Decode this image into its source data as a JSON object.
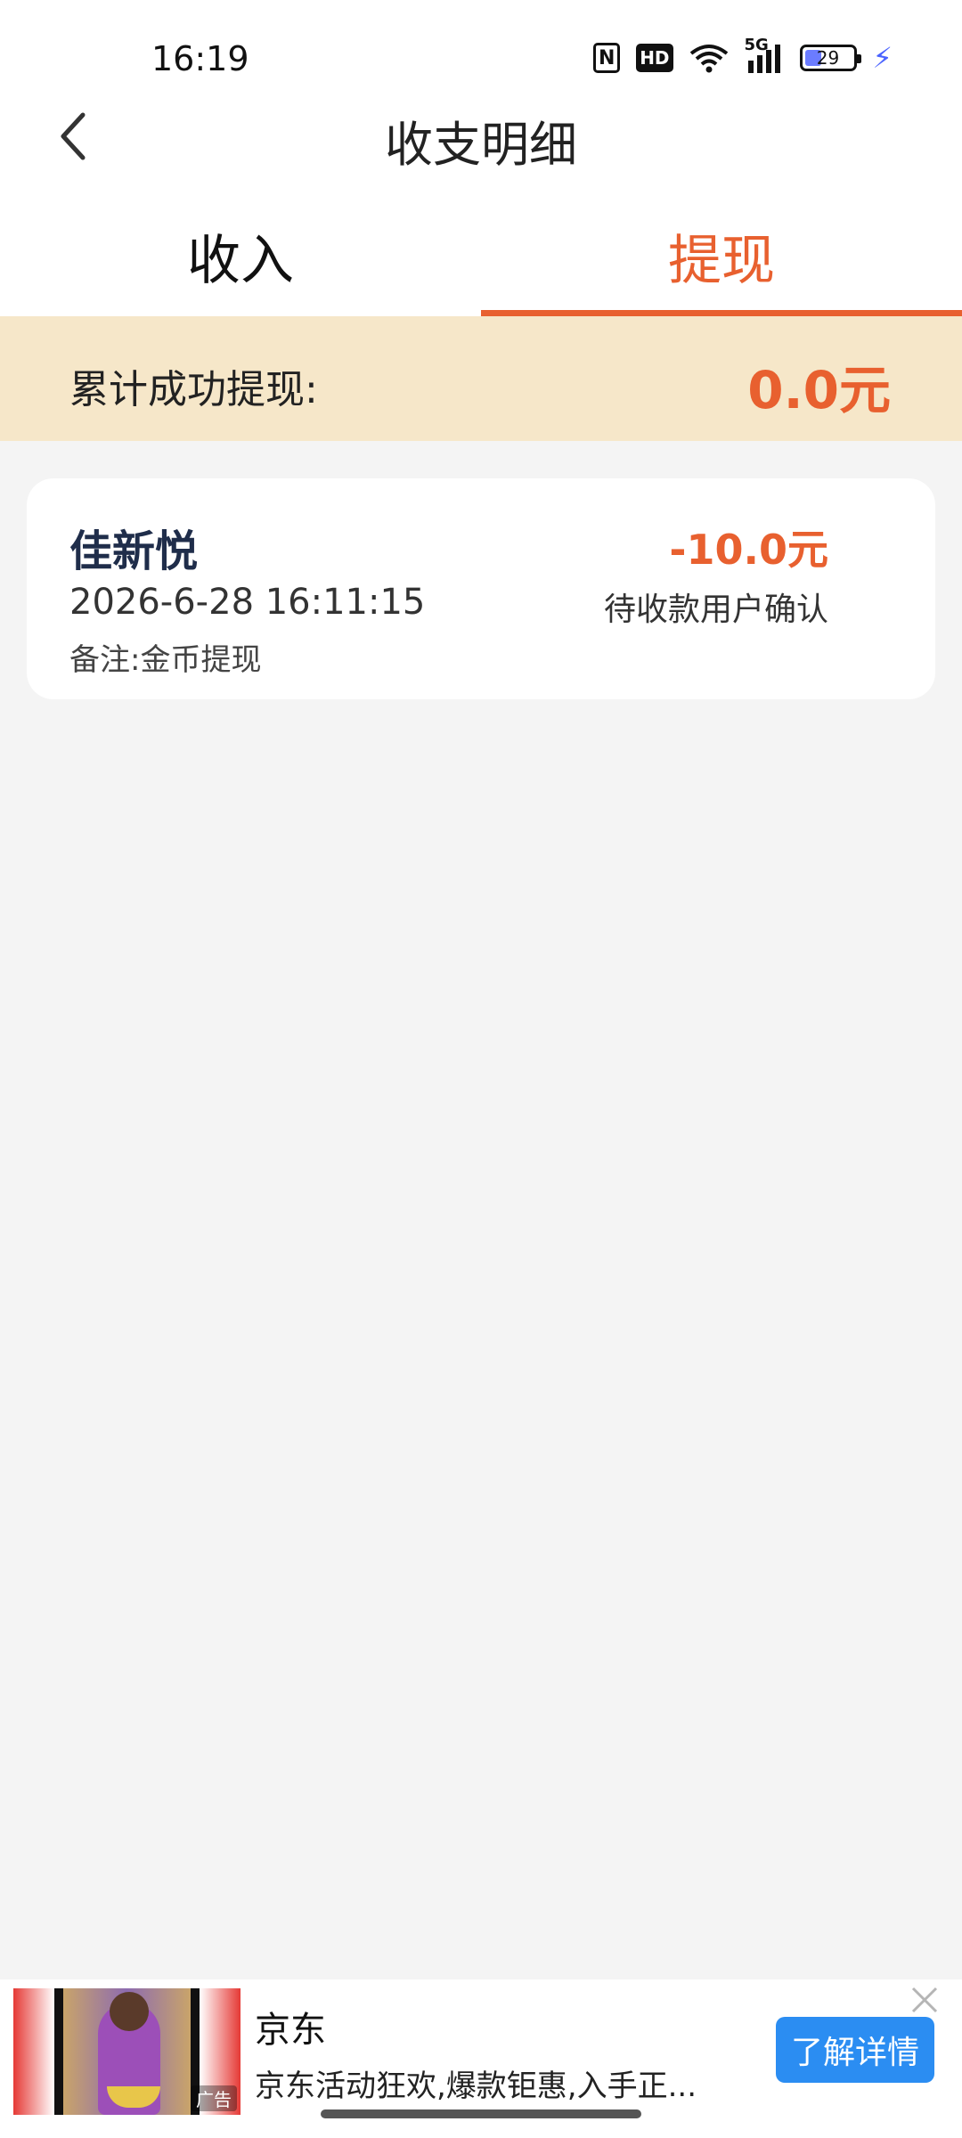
{
  "status_bar": {
    "time": "16:19",
    "nfc": "N",
    "hd": "HD",
    "signal": "5G",
    "battery": "29"
  },
  "header": {
    "title": "收支明细"
  },
  "tabs": [
    {
      "label": "收入",
      "active": false
    },
    {
      "label": "提现",
      "active": true
    }
  ],
  "summary": {
    "label": "累计成功提现:",
    "amount": "0.0元"
  },
  "records": [
    {
      "name": "佳新悦",
      "time": "2026-6-28 16:11:15",
      "note": "备注:金币提现",
      "amount": "-10.0元",
      "status": "待收款用户确认"
    }
  ],
  "ad": {
    "title": "京东",
    "description": "京东活动狂欢,爆款钜惠,入手正...",
    "button": "了解详情",
    "tag": "广告"
  },
  "colors": {
    "accent": "#e8602f",
    "summary_bg": "#f6e7c9",
    "ad_button": "#2b8df2"
  }
}
